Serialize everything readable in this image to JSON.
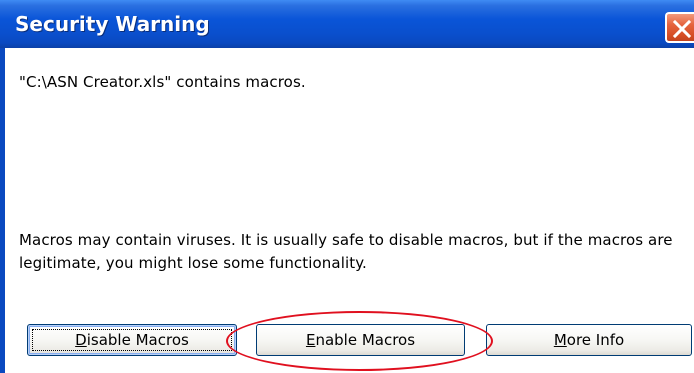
{
  "dialog": {
    "title": "Security Warning",
    "file_message": "\"C:\\ASN Creator.xls\" contains macros.",
    "warning_message": "Macros may contain viruses. It is usually safe to disable macros, but if the macros are legitimate, you might lose some functionality."
  },
  "buttons": {
    "disable": {
      "mnemonic": "D",
      "rest": "isable Macros"
    },
    "enable": {
      "mnemonic": "E",
      "rest": "nable Macros"
    },
    "more": {
      "mnemonic": "M",
      "rest": "ore Info"
    }
  },
  "colors": {
    "titlebar": "#0a55d8",
    "close_button": "#e5633e",
    "highlight_ellipse": "#e0101f"
  },
  "icons": {
    "close": "close-icon"
  }
}
